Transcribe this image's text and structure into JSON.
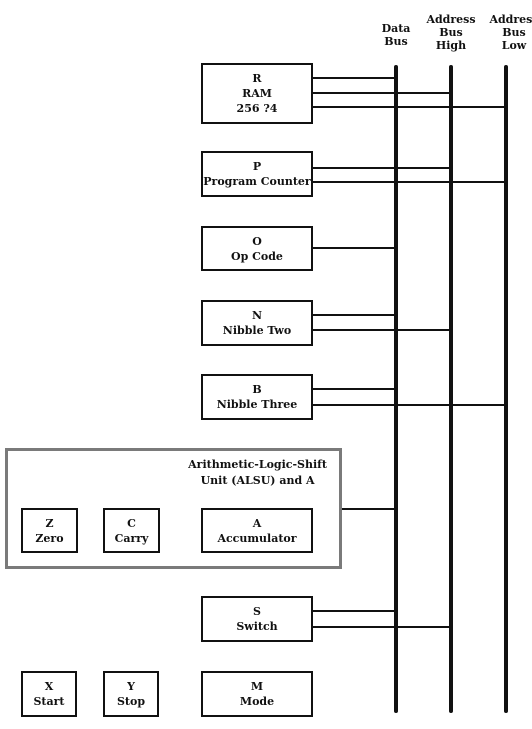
{
  "buses": [
    {
      "id": "data",
      "label_lines": [
        "Data",
        "Bus"
      ]
    },
    {
      "id": "addr-high",
      "label_lines": [
        "Address",
        "Bus",
        "High"
      ]
    },
    {
      "id": "addr-low",
      "label_lines": [
        "Address",
        "Bus",
        "Low"
      ]
    }
  ],
  "registers": {
    "ram": {
      "letter": "R",
      "name": "RAM",
      "extra": "256 ?4"
    },
    "pc": {
      "letter": "P",
      "name": "Program Counter"
    },
    "opcode": {
      "letter": "O",
      "name": "Op Code"
    },
    "nibble2": {
      "letter": "N",
      "name": "Nibble Two"
    },
    "nibble3": {
      "letter": "B",
      "name": "Nibble Three"
    },
    "zero": {
      "letter": "Z",
      "name": "Zero"
    },
    "carry": {
      "letter": "C",
      "name": "Carry"
    },
    "acc": {
      "letter": "A",
      "name": "Accumulator"
    },
    "switch": {
      "letter": "S",
      "name": "Switch"
    },
    "start": {
      "letter": "X",
      "name": "Start"
    },
    "stop": {
      "letter": "Y",
      "name": "Stop"
    },
    "mode": {
      "letter": "M",
      "name": "Mode"
    }
  },
  "alsu": {
    "title_lines": [
      "Arithmetic-Logic-Shift",
      "Unit (ALSU) and A"
    ]
  },
  "colors": {
    "line": "#111111",
    "frame": "#7a7a7a"
  }
}
